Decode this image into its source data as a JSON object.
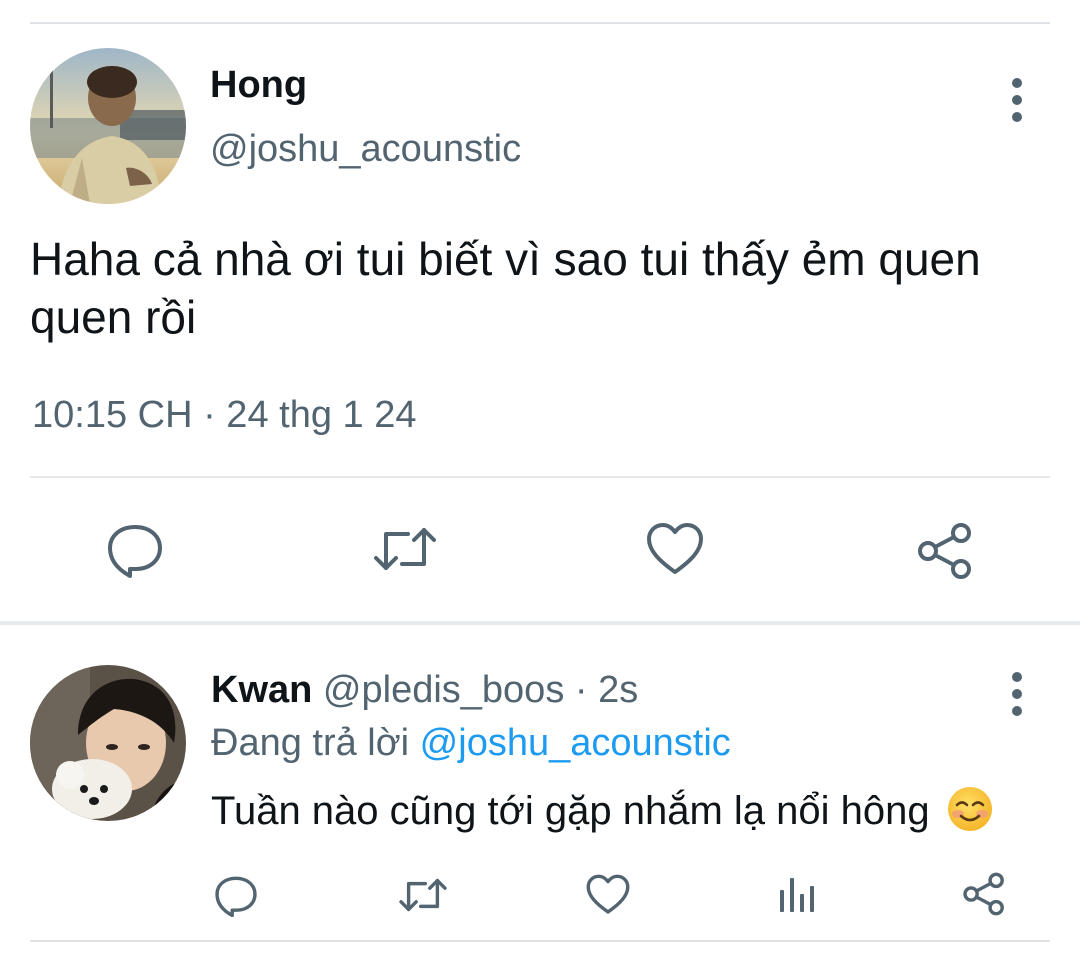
{
  "colors": {
    "text_primary": "#0f1419",
    "text_secondary": "#536471",
    "link": "#1d9bf0",
    "divider": "#e6e9eb"
  },
  "main_tweet": {
    "display_name": "Hong",
    "handle": "@joshu_acounstic",
    "text": "Haha cả nhà ơi tui biết vì sao tui thấy ẻm quen quen rồi",
    "timestamp": "10:15 CH · 24 thg 1 24",
    "avatar_icon": "user-photo-avatar",
    "more_icon": "more-vertical-icon",
    "actions": [
      "reply-icon",
      "retweet-icon",
      "like-icon",
      "share-icon"
    ]
  },
  "reply_tweet": {
    "display_name": "Kwan",
    "handle": "@pledis_boos",
    "separator": " · ",
    "age": "2s",
    "replying_prefix": "Đang trả lời ",
    "replying_to": "@joshu_acounstic",
    "text": "Tuần nào cũng tới gặp nhắm lạ nổi hông",
    "emoji": "smiling-face-with-blush-emoji",
    "avatar_icon": "user-photo-avatar",
    "more_icon": "more-vertical-icon",
    "actions": [
      "reply-icon",
      "retweet-icon",
      "like-icon",
      "analytics-icon",
      "share-icon"
    ]
  }
}
